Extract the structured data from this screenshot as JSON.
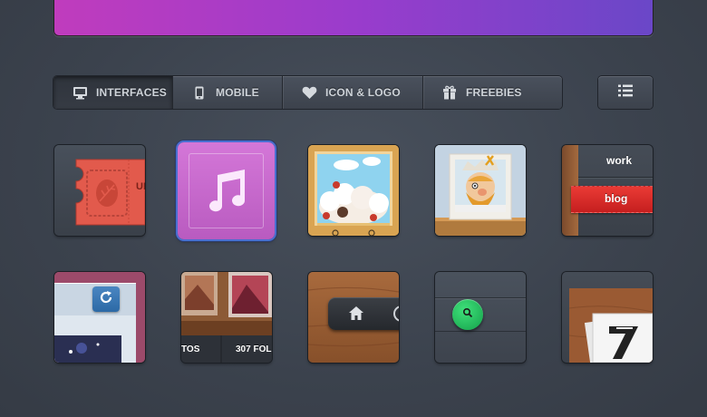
{
  "tabs": [
    {
      "label": "INTERFACES",
      "icon": "monitor-icon",
      "active": true
    },
    {
      "label": "MOBILE",
      "icon": "phone-icon",
      "active": false
    },
    {
      "label": "ICON & LOGO",
      "icon": "heart-icon",
      "active": false
    },
    {
      "label": "FREEBIES",
      "icon": "gift-icon",
      "active": false
    }
  ],
  "list_button_icon": "list-icon",
  "tiles": {
    "ticket_label": "UI",
    "music_icon": "music-note-icon",
    "menu_work": "work",
    "menu_blog": "blog",
    "refresh_icon": "refresh-icon",
    "folder_left": "TOS",
    "folder_right": "307 FOL",
    "home_icon": "home-icon",
    "search_icon": "search-icon"
  },
  "colors": {
    "accent_purple": "#9a3ccc",
    "music_pink": "#c86ad0",
    "blog_red": "#d62828",
    "search_green": "#1fbf5a"
  }
}
